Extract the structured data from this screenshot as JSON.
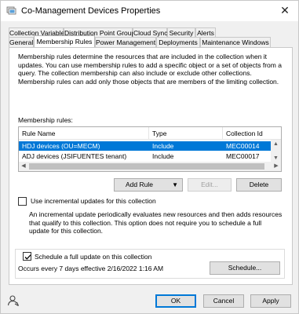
{
  "window": {
    "title": "Co-Management Devices Properties",
    "close_glyph": "✕"
  },
  "tabs": {
    "row1": [
      "Collection Variables",
      "Distribution Point Groups",
      "Cloud Sync",
      "Security",
      "Alerts"
    ],
    "row2": [
      "General",
      "Membership Rules",
      "Power Management",
      "Deployments",
      "Maintenance Windows"
    ],
    "active": "Membership Rules"
  },
  "description": "Membership rules determine the resources that are included in the collection when it updates. You can use membership rules to add a specific object or a set of objects from a query. The collection membership can also include or exclude other collections. Membership rules can add only those objects that are members of the limiting collection.",
  "membership_rules": {
    "label": "Membership rules:",
    "columns": [
      "Rule Name",
      "Type",
      "Collection Id"
    ],
    "rows": [
      {
        "name": "HDJ devices (OU=MECM)",
        "type": "Include",
        "id": "MEC00014",
        "selected": true
      },
      {
        "name": "ADJ devices (JSIFUENTES tenant)",
        "type": "Include",
        "id": "MEC00017",
        "selected": false
      },
      {
        "name": "",
        "type": "",
        "id": "",
        "selected": false
      }
    ]
  },
  "buttons": {
    "add_rule": "Add Rule",
    "edit": "Edit...",
    "delete": "Delete",
    "schedule": "Schedule...",
    "ok": "OK",
    "cancel": "Cancel",
    "apply": "Apply"
  },
  "incremental": {
    "label": "Use incremental updates for this collection",
    "checked": false,
    "description": "An incremental update periodically evaluates new resources and then adds resources that qualify to this collection. This option does not require you to schedule a full update for this collection."
  },
  "full_update": {
    "label": "Schedule a full update on this collection",
    "checked": true,
    "schedule_text": "Occurs every 7 days effective 2/16/2022 1:16 AM"
  },
  "icons": {
    "title": "collection-icon",
    "footer": "user-help-icon",
    "dropdown": "chevron-down-icon"
  }
}
